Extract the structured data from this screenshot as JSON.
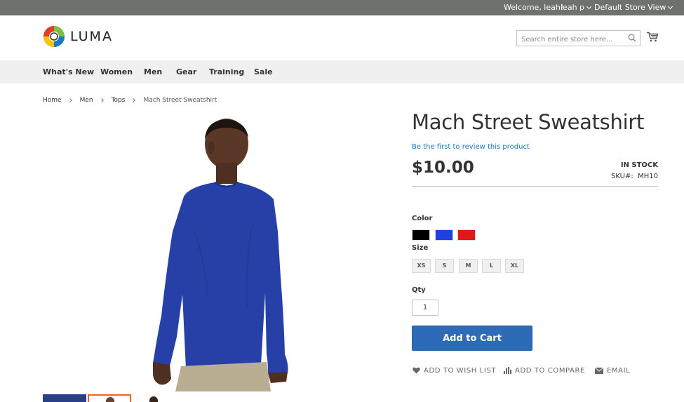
{
  "topbar": {
    "welcome": "Welcome, leah!",
    "user": "leah p",
    "store_view": "Default Store View"
  },
  "header": {
    "logo_text": "LUMA",
    "search_placeholder": "Search entire store here...",
    "search_icon": "search-icon",
    "cart_icon": "cart-icon"
  },
  "nav": {
    "items": [
      {
        "label": "What's New"
      },
      {
        "label": "Women"
      },
      {
        "label": "Men"
      },
      {
        "label": "Gear"
      },
      {
        "label": "Training"
      },
      {
        "label": "Sale"
      }
    ]
  },
  "breadcrumb": {
    "items": [
      {
        "label": "Home"
      },
      {
        "label": "Men"
      },
      {
        "label": "Tops"
      },
      {
        "label": "Mach Street Sweatshirt"
      }
    ]
  },
  "product": {
    "title": "Mach Street Sweatshirt",
    "review_link": "Be the first to review this product",
    "price": "$10.00",
    "stock": "IN STOCK",
    "sku_label": "SKU#:",
    "sku": "MH10",
    "color_label": "Color",
    "colors": [
      {
        "name": "Black",
        "hex": "#000000"
      },
      {
        "name": "Blue",
        "hex": "#1f3fe0"
      },
      {
        "name": "Red",
        "hex": "#e0181b"
      }
    ],
    "size_label": "Size",
    "sizes": [
      "XS",
      "S",
      "M",
      "L",
      "XL"
    ],
    "qty_label": "Qty",
    "qty_value": "1",
    "add_to_cart": "Add to Cart",
    "actions": {
      "wishlist": "ADD TO WISH LIST",
      "compare": "ADD TO COMPARE",
      "email": "EMAIL"
    }
  },
  "colors": {
    "topbar_bg": "#6e716e",
    "nav_bg": "#f0f0f0",
    "accent": "#2d6bb9",
    "link": "#1979c3"
  }
}
